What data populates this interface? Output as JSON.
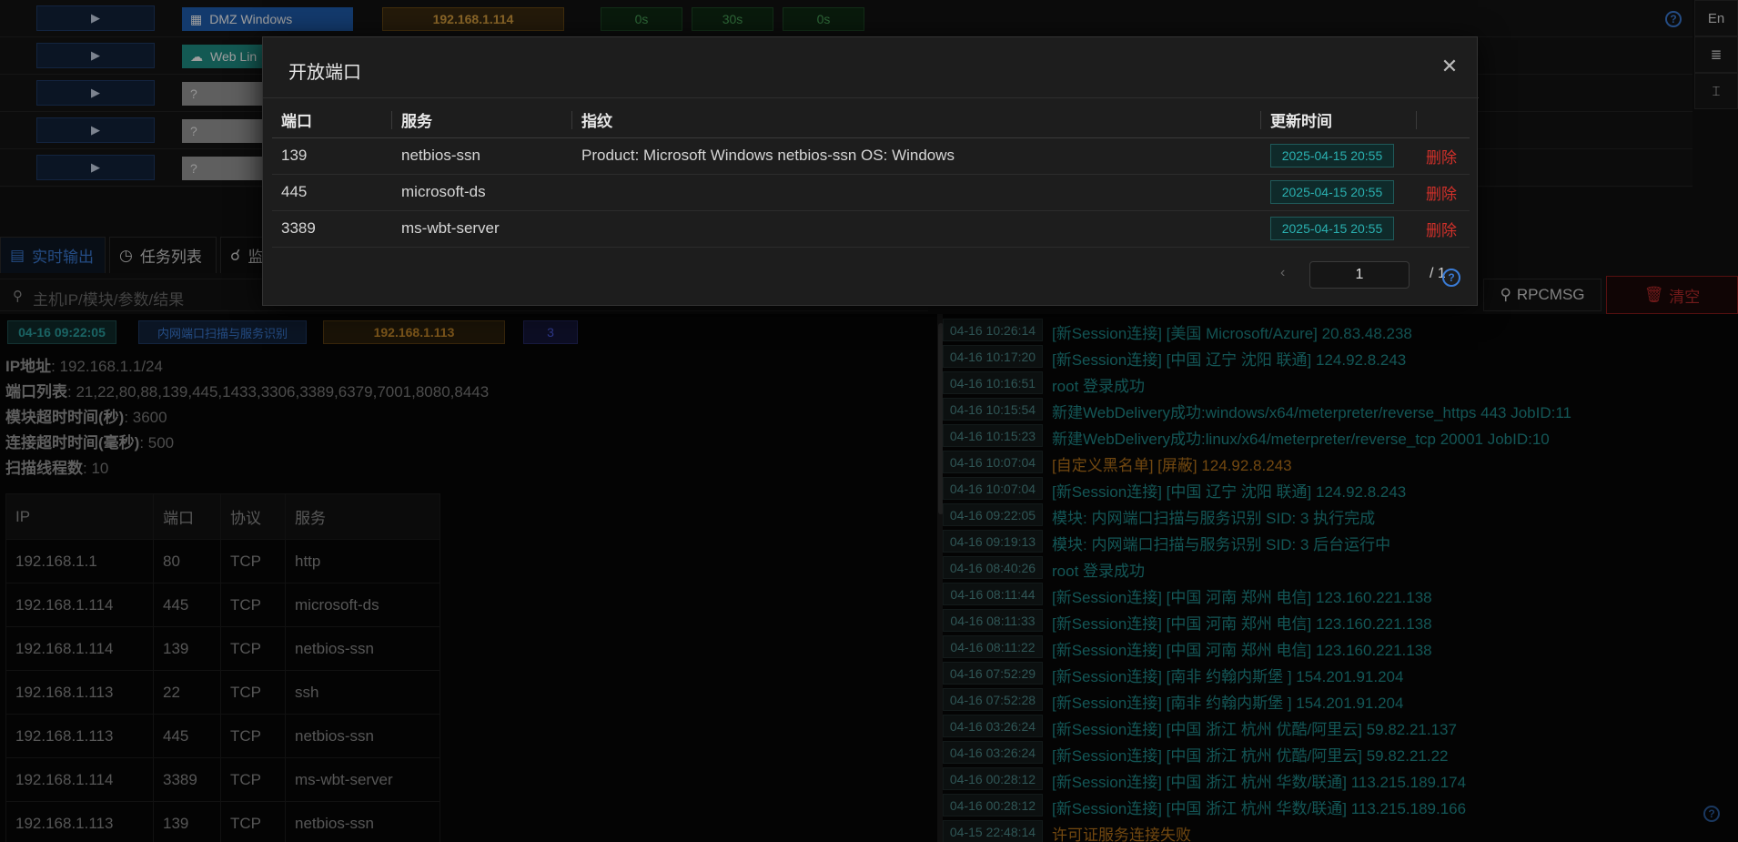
{
  "sessions": [
    {
      "arrow": "▶",
      "type": "DMZ Windows",
      "ip": "192.168.1.114",
      "t1": "0s",
      "t2": "30s",
      "t3": "0s"
    },
    {
      "arrow": "▶",
      "type": "Web Lin"
    },
    {
      "arrow": "▶",
      "type": "?"
    },
    {
      "arrow": "▶",
      "type": "?"
    },
    {
      "arrow": "▶",
      "type": "?"
    }
  ],
  "help_label": "?",
  "toolbar": {
    "lang": "En",
    "menu_icon": "≣",
    "fit_icon": "⌶"
  },
  "tabs": [
    {
      "label": "实时输出",
      "icon": "output-icon"
    },
    {
      "label": "任务列表",
      "icon": "clock-icon"
    },
    {
      "label": "监",
      "icon": "headset-icon"
    }
  ],
  "search": {
    "placeholder": "主机IP/模块/参数/结果"
  },
  "rpc_button": "RPCMSG",
  "clear_button": "清空",
  "output": {
    "time": "04-16 09:22:05",
    "module": "内网端口扫描与服务识别",
    "ip": "192.168.1.113",
    "sid": "3",
    "params": [
      {
        "key": "IP地址",
        "value": ": 192.168.1.1/24"
      },
      {
        "key": "端口列表",
        "value": ": 21,22,80,88,139,445,1433,3306,3389,6379,7001,8080,8443"
      },
      {
        "key": "模块超时时间(秒)",
        "value": ": 3600"
      },
      {
        "key": "连接超时时间(毫秒)",
        "value": ": 500"
      },
      {
        "key": "扫描线程数",
        "value": ": 10"
      }
    ],
    "table_headers": [
      "IP",
      "端口",
      "协议",
      "服务"
    ],
    "table_rows": [
      [
        "192.168.1.1",
        "80",
        "TCP",
        "http"
      ],
      [
        "192.168.1.114",
        "445",
        "TCP",
        "microsoft-ds"
      ],
      [
        "192.168.1.114",
        "139",
        "TCP",
        "netbios-ssn"
      ],
      [
        "192.168.1.113",
        "22",
        "TCP",
        "ssh"
      ],
      [
        "192.168.1.113",
        "445",
        "TCP",
        "netbios-ssn"
      ],
      [
        "192.168.1.114",
        "3389",
        "TCP",
        "ms-wbt-server"
      ],
      [
        "192.168.1.113",
        "139",
        "TCP",
        "netbios-ssn"
      ]
    ]
  },
  "logs": [
    {
      "time": "04-16 10:26:14",
      "msg": "[新Session连接] [美国 Microsoft/Azure] 20.83.48.238",
      "color": "teal"
    },
    {
      "time": "04-16 10:17:20",
      "msg": "[新Session连接] [中国 辽宁 沈阳 联通] 124.92.8.243",
      "color": "teal"
    },
    {
      "time": "04-16 10:16:51",
      "msg": "root 登录成功",
      "color": "teal"
    },
    {
      "time": "04-16 10:15:54",
      "msg": "新建WebDelivery成功:windows/x64/meterpreter/reverse_https 443 JobID:11",
      "color": "teal"
    },
    {
      "time": "04-16 10:15:23",
      "msg": "新建WebDelivery成功:linux/x64/meterpreter/reverse_tcp 20001 JobID:10",
      "color": "teal"
    },
    {
      "time": "04-16 10:07:04",
      "msg": "[自定义黑名单] [屏蔽] 124.92.8.243",
      "color": "orange"
    },
    {
      "time": "04-16 10:07:04",
      "msg": "[新Session连接] [中国 辽宁 沈阳 联通] 124.92.8.243",
      "color": "teal"
    },
    {
      "time": "04-16 09:22:05",
      "msg": "模块: 内网端口扫描与服务识别 SID: 3 执行完成",
      "color": "teal"
    },
    {
      "time": "04-16 09:19:13",
      "msg": "模块: 内网端口扫描与服务识别 SID: 3 后台运行中",
      "color": "teal"
    },
    {
      "time": "04-16 08:40:26",
      "msg": "root 登录成功",
      "color": "teal"
    },
    {
      "time": "04-16 08:11:44",
      "msg": "[新Session连接] [中国 河南 郑州 电信] 123.160.221.138",
      "color": "teal"
    },
    {
      "time": "04-16 08:11:33",
      "msg": "[新Session连接] [中国 河南 郑州 电信] 123.160.221.138",
      "color": "teal"
    },
    {
      "time": "04-16 08:11:22",
      "msg": "[新Session连接] [中国 河南 郑州 电信] 123.160.221.138",
      "color": "teal"
    },
    {
      "time": "04-16 07:52:29",
      "msg": "[新Session连接] [南非 约翰内斯堡 ] 154.201.91.204",
      "color": "teal"
    },
    {
      "time": "04-16 07:52:28",
      "msg": "[新Session连接] [南非 约翰内斯堡 ] 154.201.91.204",
      "color": "teal"
    },
    {
      "time": "04-16 03:26:24",
      "msg": "[新Session连接] [中国 浙江 杭州 优酷/阿里云] 59.82.21.137",
      "color": "teal"
    },
    {
      "time": "04-16 03:26:24",
      "msg": "[新Session连接] [中国 浙江 杭州 优酷/阿里云] 59.82.21.22",
      "color": "teal"
    },
    {
      "time": "04-16 00:28:12",
      "msg": "[新Session连接] [中国 浙江 杭州 华数/联通] 113.215.189.174",
      "color": "teal"
    },
    {
      "time": "04-16 00:28:12",
      "msg": "[新Session连接] [中国 浙江 杭州 华数/联通] 113.215.189.166",
      "color": "teal"
    },
    {
      "time": "04-15 22:48:14",
      "msg": "许可证服务连接失败",
      "color": "orange"
    }
  ],
  "modal": {
    "title": "开放端口",
    "close": "✕",
    "headers": [
      "端口",
      "服务",
      "指纹",
      "更新时间",
      ""
    ],
    "rows": [
      {
        "port": "139",
        "service": "netbios-ssn",
        "fingerprint": "Product: Microsoft Windows netbios-ssn OS: Windows",
        "updated": "2025-04-15 20:55",
        "action": "删除"
      },
      {
        "port": "445",
        "service": "microsoft-ds",
        "fingerprint": "",
        "updated": "2025-04-15 20:55",
        "action": "删除"
      },
      {
        "port": "3389",
        "service": "ms-wbt-server",
        "fingerprint": "",
        "updated": "2025-04-15 20:55",
        "action": "删除"
      }
    ],
    "pager": {
      "prev": "‹",
      "current": "1",
      "total": "/ 1",
      "help": "?"
    }
  },
  "colors": {
    "teal": "#1f8a8a",
    "orange": "#b8741a",
    "accent": "#3a7bd5",
    "danger": "#d0302a"
  }
}
